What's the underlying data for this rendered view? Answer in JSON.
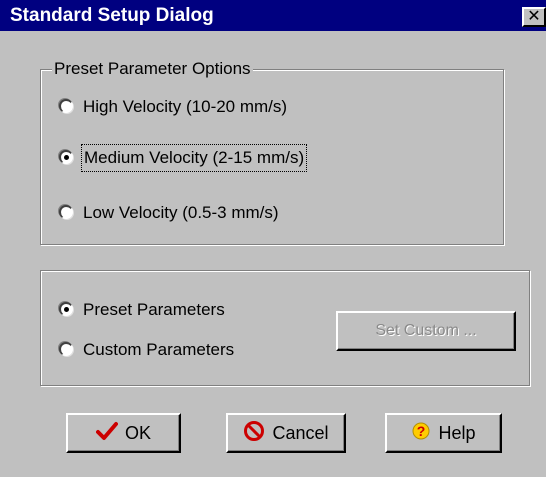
{
  "window": {
    "title": "Standard Setup Dialog",
    "close_glyph": "✕"
  },
  "presets": {
    "legend": "Preset Parameter Options",
    "options": [
      {
        "label": "High Velocity (10-20 mm/s)",
        "selected": false
      },
      {
        "label": "Medium Velocity (2-15 mm/s)",
        "selected": true
      },
      {
        "label": "Low Velocity (0.5-3 mm/s)",
        "selected": false
      }
    ]
  },
  "mode": {
    "options": [
      {
        "label": "Preset Parameters",
        "selected": true
      },
      {
        "label": "Custom Parameters",
        "selected": false
      }
    ],
    "set_custom_label": "Set Custom ..."
  },
  "buttons": {
    "ok": {
      "label": "OK",
      "icon": "checkmark-icon",
      "color": "#cc0000"
    },
    "cancel": {
      "label": "Cancel",
      "icon": "no-entry-icon",
      "color": "#cc0000"
    },
    "help": {
      "label": "Help",
      "icon": "question-icon",
      "color": "#ffcc00"
    }
  }
}
